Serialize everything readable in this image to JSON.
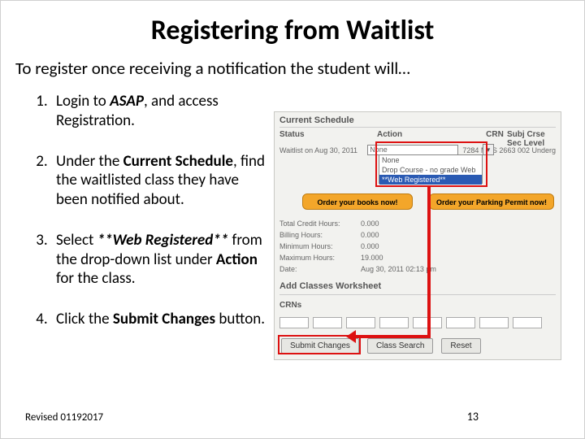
{
  "title": "Registering from Waitlist",
  "intro": "To register once receiving a notification the student will…",
  "steps": {
    "s1a": "Login to ",
    "s1b": "ASAP",
    "s1c": ", and access Registration.",
    "s2a": "Under the ",
    "s2b": "Current Schedule",
    "s2c": ", find the waitlisted class they have been notified about.",
    "s3a": "Select ",
    "s3b": "**Web Registered**",
    "s3c": " from the drop-down list under ",
    "s3d": "Action",
    "s3e": " for the class.",
    "s4a": "Click the ",
    "s4b": "Submit Changes",
    "s4c": " button."
  },
  "footer": {
    "revised": "Revised 01192017",
    "page": "13"
  },
  "shot": {
    "current_schedule": "Current Schedule",
    "headers": {
      "status": "Status",
      "action": "Action",
      "crn": "CRN",
      "rest": "Subj Crse Sec Level"
    },
    "status_row": "Waitlist on Aug 30, 2011",
    "sel_none": "None",
    "row_rest": "7284 MUS  2663 002 Underg",
    "dd": {
      "o1": "None",
      "o2": "Drop Course - no grade Web",
      "o3": "**Web Registered**"
    },
    "btn_books": "Order your books now!",
    "btn_parking": "Order your Parking Permit now!",
    "info": {
      "tch": "Total Credit Hours:",
      "tchv": "0.000",
      "bh": "Billing Hours:",
      "bhv": "0.000",
      "mnh": "Minimum Hours:",
      "mnhv": "0.000",
      "mxh": "Maximum Hours:",
      "mxhv": "19.000",
      "dt": "Date:",
      "dtv": "Aug 30, 2011 02:13 pm"
    },
    "worksheet": "Add Classes Worksheet",
    "crns": "CRNs",
    "submit": "Submit Changes",
    "search": "Class Search",
    "reset": "Reset"
  }
}
